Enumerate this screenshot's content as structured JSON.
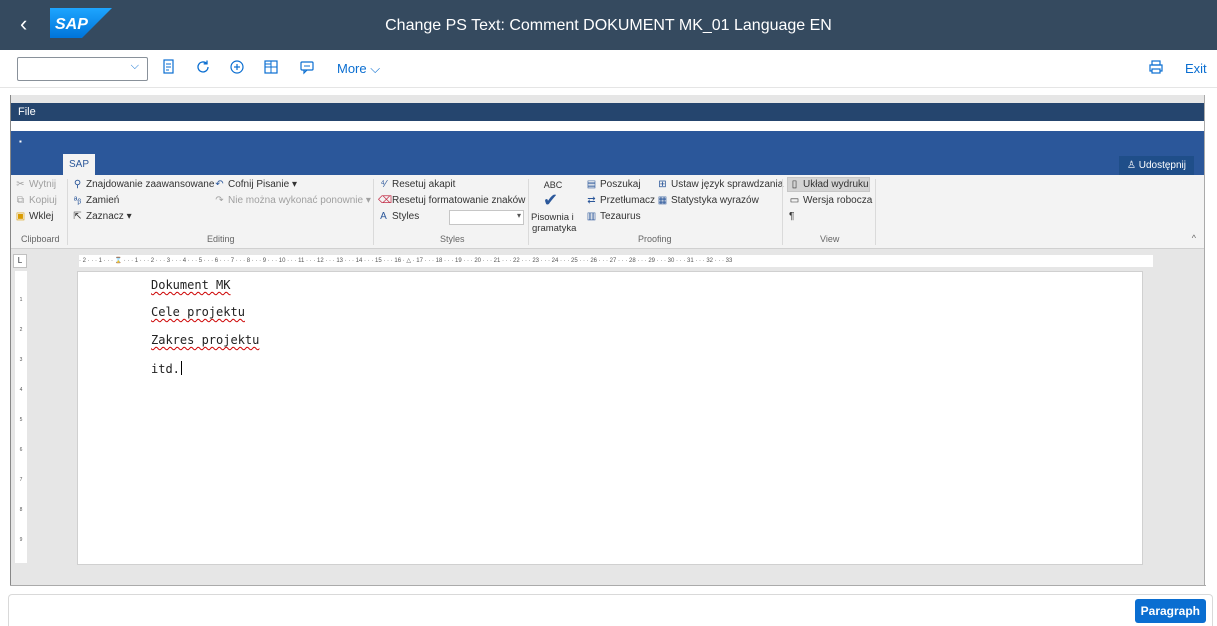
{
  "shell": {
    "back": "‹",
    "logo": "SAP",
    "title": "Change PS Text: Comment DOKUMENT MK_01 Language EN"
  },
  "toolbar": {
    "select_value": "",
    "chevron": "⌵",
    "icons": [
      "save-as-icon",
      "refresh-icon",
      "add-icon",
      "layout-icon",
      "message-icon"
    ],
    "more": "More ⌵",
    "print": "print-icon",
    "exit": "Exit"
  },
  "word": {
    "file_tab": "File",
    "quick_dot": "▪",
    "sap_tab": "SAP",
    "share": "Udostępnij",
    "clipboard": {
      "cut": "Wytnij",
      "copy": "Kopiuj",
      "paste": "Wklej",
      "label": "Clipboard"
    },
    "editing": {
      "find_adv": "Znajdowanie zaawansowane",
      "undo": "Cofnij Pisanie",
      "replace": "Zamień",
      "redo": "Nie można wykonać ponownie",
      "select": "Zaznacz",
      "label": "Editing"
    },
    "styles": {
      "reset_para": "Resetuj akapit",
      "reset_char": "Resetuj formatowanie znaków",
      "styles": "Styles",
      "label": "Styles"
    },
    "proofing": {
      "abc": "ABC",
      "spelling_1": "Pisownia i",
      "spelling_2": "gramatyka",
      "search": "Poszukaj",
      "translate": "Przetłumacz",
      "thesaurus": "Tezaurus",
      "set_lang": "Ustaw język sprawdzania",
      "word_stats": "Statystyka wyrazów",
      "label": "Proofing"
    },
    "view": {
      "print_layout": "Układ wydruku",
      "draft": "Wersja robocza",
      "pilcrow": "¶",
      "label": "View"
    },
    "ruler": "· 2 · · · 1 · · · ⌛ · · · 1 · · · 2 · · · 3 · · · 4 · · · 5 · · · 6 · · · 7 · · · 8 · · · 9 · · · 10 · · · 11 · · · 12 · · · 13 · · · 14 · · · 15 · · · 16 · △ · 17 · · · 18 · · · 19 · · · 20 · · · 21 · · · 22 · · · 23 · · · 24 · · · 25 · · · 26 · · · 27 · · · 28 · · · 29 · · · 30 · · · 31 · · · 32 · · · 33",
    "tab_selector": "L",
    "document": {
      "lines": [
        "Dokument MK",
        "Cele projektu",
        "Zakres projektu",
        "itd."
      ]
    }
  },
  "footer": {
    "paragraph": "Paragraph"
  }
}
